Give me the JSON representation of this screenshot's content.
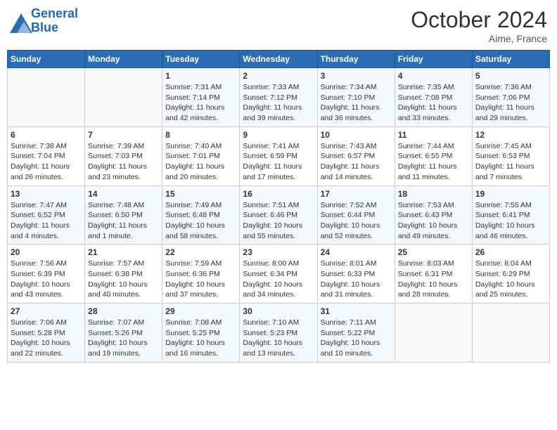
{
  "logo": {
    "line1": "General",
    "line2": "Blue"
  },
  "header": {
    "month": "October 2024",
    "location": "Aime, France"
  },
  "weekdays": [
    "Sunday",
    "Monday",
    "Tuesday",
    "Wednesday",
    "Thursday",
    "Friday",
    "Saturday"
  ],
  "weeks": [
    [
      {
        "day": "",
        "sunrise": "",
        "sunset": "",
        "daylight": ""
      },
      {
        "day": "",
        "sunrise": "",
        "sunset": "",
        "daylight": ""
      },
      {
        "day": "1",
        "sunrise": "Sunrise: 7:31 AM",
        "sunset": "Sunset: 7:14 PM",
        "daylight": "Daylight: 11 hours and 42 minutes."
      },
      {
        "day": "2",
        "sunrise": "Sunrise: 7:33 AM",
        "sunset": "Sunset: 7:12 PM",
        "daylight": "Daylight: 11 hours and 39 minutes."
      },
      {
        "day": "3",
        "sunrise": "Sunrise: 7:34 AM",
        "sunset": "Sunset: 7:10 PM",
        "daylight": "Daylight: 11 hours and 36 minutes."
      },
      {
        "day": "4",
        "sunrise": "Sunrise: 7:35 AM",
        "sunset": "Sunset: 7:08 PM",
        "daylight": "Daylight: 11 hours and 33 minutes."
      },
      {
        "day": "5",
        "sunrise": "Sunrise: 7:36 AM",
        "sunset": "Sunset: 7:06 PM",
        "daylight": "Daylight: 11 hours and 29 minutes."
      }
    ],
    [
      {
        "day": "6",
        "sunrise": "Sunrise: 7:38 AM",
        "sunset": "Sunset: 7:04 PM",
        "daylight": "Daylight: 11 hours and 26 minutes."
      },
      {
        "day": "7",
        "sunrise": "Sunrise: 7:39 AM",
        "sunset": "Sunset: 7:03 PM",
        "daylight": "Daylight: 11 hours and 23 minutes."
      },
      {
        "day": "8",
        "sunrise": "Sunrise: 7:40 AM",
        "sunset": "Sunset: 7:01 PM",
        "daylight": "Daylight: 11 hours and 20 minutes."
      },
      {
        "day": "9",
        "sunrise": "Sunrise: 7:41 AM",
        "sunset": "Sunset: 6:59 PM",
        "daylight": "Daylight: 11 hours and 17 minutes."
      },
      {
        "day": "10",
        "sunrise": "Sunrise: 7:43 AM",
        "sunset": "Sunset: 6:57 PM",
        "daylight": "Daylight: 11 hours and 14 minutes."
      },
      {
        "day": "11",
        "sunrise": "Sunrise: 7:44 AM",
        "sunset": "Sunset: 6:55 PM",
        "daylight": "Daylight: 11 hours and 11 minutes."
      },
      {
        "day": "12",
        "sunrise": "Sunrise: 7:45 AM",
        "sunset": "Sunset: 6:53 PM",
        "daylight": "Daylight: 11 hours and 7 minutes."
      }
    ],
    [
      {
        "day": "13",
        "sunrise": "Sunrise: 7:47 AM",
        "sunset": "Sunset: 6:52 PM",
        "daylight": "Daylight: 11 hours and 4 minutes."
      },
      {
        "day": "14",
        "sunrise": "Sunrise: 7:48 AM",
        "sunset": "Sunset: 6:50 PM",
        "daylight": "Daylight: 11 hours and 1 minute."
      },
      {
        "day": "15",
        "sunrise": "Sunrise: 7:49 AM",
        "sunset": "Sunset: 6:48 PM",
        "daylight": "Daylight: 10 hours and 58 minutes."
      },
      {
        "day": "16",
        "sunrise": "Sunrise: 7:51 AM",
        "sunset": "Sunset: 6:46 PM",
        "daylight": "Daylight: 10 hours and 55 minutes."
      },
      {
        "day": "17",
        "sunrise": "Sunrise: 7:52 AM",
        "sunset": "Sunset: 6:44 PM",
        "daylight": "Daylight: 10 hours and 52 minutes."
      },
      {
        "day": "18",
        "sunrise": "Sunrise: 7:53 AM",
        "sunset": "Sunset: 6:43 PM",
        "daylight": "Daylight: 10 hours and 49 minutes."
      },
      {
        "day": "19",
        "sunrise": "Sunrise: 7:55 AM",
        "sunset": "Sunset: 6:41 PM",
        "daylight": "Daylight: 10 hours and 46 minutes."
      }
    ],
    [
      {
        "day": "20",
        "sunrise": "Sunrise: 7:56 AM",
        "sunset": "Sunset: 6:39 PM",
        "daylight": "Daylight: 10 hours and 43 minutes."
      },
      {
        "day": "21",
        "sunrise": "Sunrise: 7:57 AM",
        "sunset": "Sunset: 6:38 PM",
        "daylight": "Daylight: 10 hours and 40 minutes."
      },
      {
        "day": "22",
        "sunrise": "Sunrise: 7:59 AM",
        "sunset": "Sunset: 6:36 PM",
        "daylight": "Daylight: 10 hours and 37 minutes."
      },
      {
        "day": "23",
        "sunrise": "Sunrise: 8:00 AM",
        "sunset": "Sunset: 6:34 PM",
        "daylight": "Daylight: 10 hours and 34 minutes."
      },
      {
        "day": "24",
        "sunrise": "Sunrise: 8:01 AM",
        "sunset": "Sunset: 6:33 PM",
        "daylight": "Daylight: 10 hours and 31 minutes."
      },
      {
        "day": "25",
        "sunrise": "Sunrise: 8:03 AM",
        "sunset": "Sunset: 6:31 PM",
        "daylight": "Daylight: 10 hours and 28 minutes."
      },
      {
        "day": "26",
        "sunrise": "Sunrise: 8:04 AM",
        "sunset": "Sunset: 6:29 PM",
        "daylight": "Daylight: 10 hours and 25 minutes."
      }
    ],
    [
      {
        "day": "27",
        "sunrise": "Sunrise: 7:06 AM",
        "sunset": "Sunset: 5:28 PM",
        "daylight": "Daylight: 10 hours and 22 minutes."
      },
      {
        "day": "28",
        "sunrise": "Sunrise: 7:07 AM",
        "sunset": "Sunset: 5:26 PM",
        "daylight": "Daylight: 10 hours and 19 minutes."
      },
      {
        "day": "29",
        "sunrise": "Sunrise: 7:08 AM",
        "sunset": "Sunset: 5:25 PM",
        "daylight": "Daylight: 10 hours and 16 minutes."
      },
      {
        "day": "30",
        "sunrise": "Sunrise: 7:10 AM",
        "sunset": "Sunset: 5:23 PM",
        "daylight": "Daylight: 10 hours and 13 minutes."
      },
      {
        "day": "31",
        "sunrise": "Sunrise: 7:11 AM",
        "sunset": "Sunset: 5:22 PM",
        "daylight": "Daylight: 10 hours and 10 minutes."
      },
      {
        "day": "",
        "sunrise": "",
        "sunset": "",
        "daylight": ""
      },
      {
        "day": "",
        "sunrise": "",
        "sunset": "",
        "daylight": ""
      }
    ]
  ]
}
